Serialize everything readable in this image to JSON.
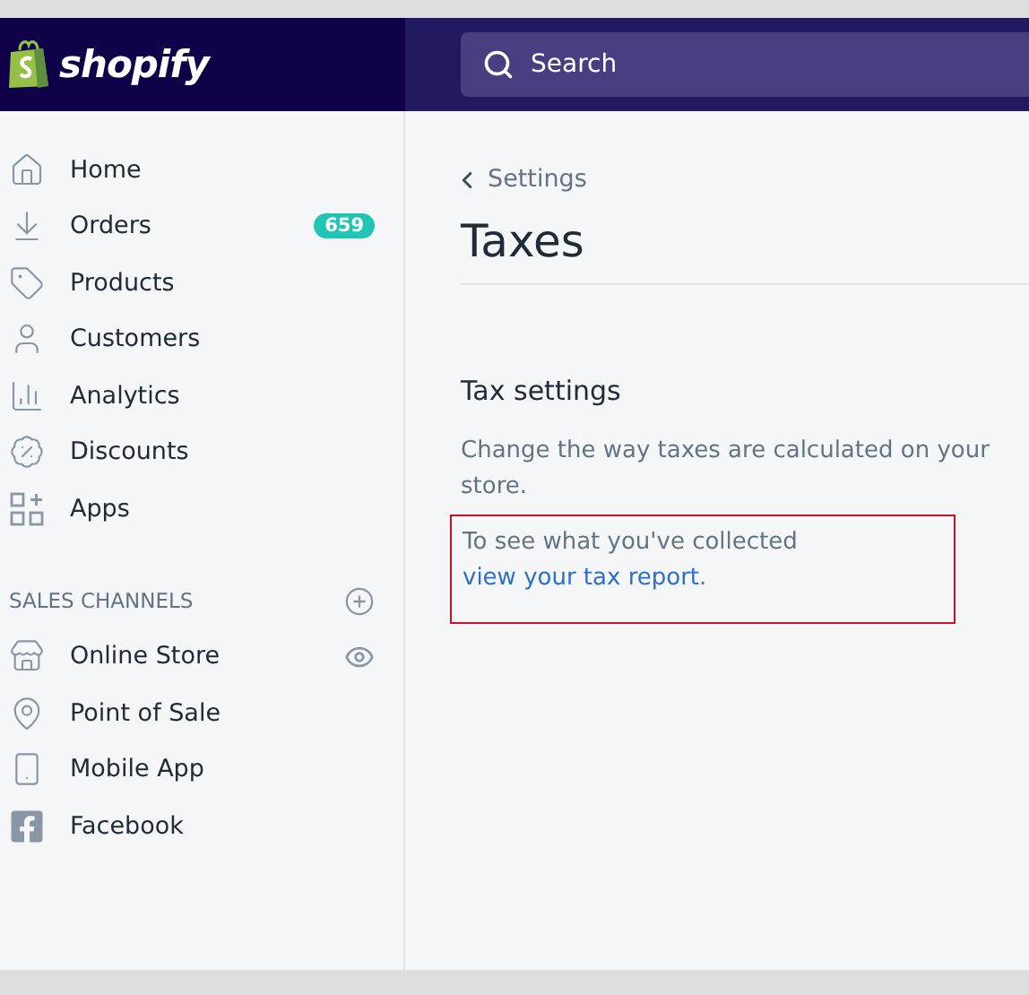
{
  "header": {
    "logo": "shopify",
    "search": {
      "placeholder": "Search"
    }
  },
  "sidebar": {
    "items": [
      {
        "label": "Home"
      },
      {
        "label": "Orders",
        "badge": "659"
      },
      {
        "label": "Products"
      },
      {
        "label": "Customers"
      },
      {
        "label": "Analytics"
      },
      {
        "label": "Discounts"
      },
      {
        "label": "Apps"
      }
    ],
    "sales_channels": {
      "title": "SALES CHANNELS",
      "items": [
        {
          "label": "Online Store",
          "viewable": true
        },
        {
          "label": "Point of Sale",
          "viewable": false
        },
        {
          "label": "Mobile App",
          "viewable": false
        },
        {
          "label": "Facebook",
          "viewable": false
        }
      ]
    }
  },
  "page": {
    "breadcrumb": "Settings",
    "title": "Taxes",
    "section": {
      "title": "Tax settings",
      "description": "Change the way taxes are calculated on your store.",
      "note": {
        "text": "To see what you've collected",
        "link": "view your tax report",
        "suffix": ".",
        "highlighted": true
      }
    }
  }
}
